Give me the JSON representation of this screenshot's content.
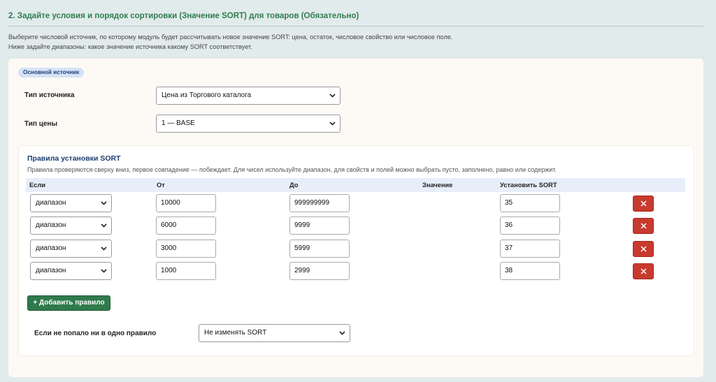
{
  "section": {
    "title": "2. Задайте условия и порядок сортировки (Значение SORT) для товаров (Обязательно)",
    "description": "Выберите числовой источник, по которому модуль будет рассчитывать новое значение SORT: цена, остаток, числовое свойство или числовое поле. Ниже задайте диапазоны: какое значение источника какому SORT соответствует."
  },
  "source": {
    "badge": "Основной источник",
    "type_label": "Тип источника",
    "type_value": "Цена из Торгового каталога",
    "price_label": "Тип цены",
    "price_value": "1 — BASE"
  },
  "rules": {
    "title": "Правила установки SORT",
    "note": "Правила проверяются сверху вниз, первое совпадение — побеждает. Для чисел используйте диапазон, для свойств и полей можно выбрать пусто, заполнено, равно или содержит.",
    "columns": {
      "if": "Если",
      "from": "От",
      "to": "До",
      "value": "Значение",
      "set_sort": "Установить SORT"
    },
    "rows": [
      {
        "condition": "диапазон",
        "from": "10000",
        "to": "999999999",
        "sort": "35"
      },
      {
        "condition": "диапазон",
        "from": "6000",
        "to": "9999",
        "sort": "36"
      },
      {
        "condition": "диапазон",
        "from": "3000",
        "to": "5999",
        "sort": "37"
      },
      {
        "condition": "диапазон",
        "from": "1000",
        "to": "2999",
        "sort": "38"
      }
    ],
    "delete_glyph": "✕",
    "add_label": "+ Добавить правило",
    "fallback_label": "Если не попало ни в одно правило",
    "fallback_value": "Не изменять SORT"
  },
  "colors": {
    "accent_green": "#2e7d4f",
    "delete_red": "#c83a2e",
    "badge_bg": "#d6e3f6"
  }
}
